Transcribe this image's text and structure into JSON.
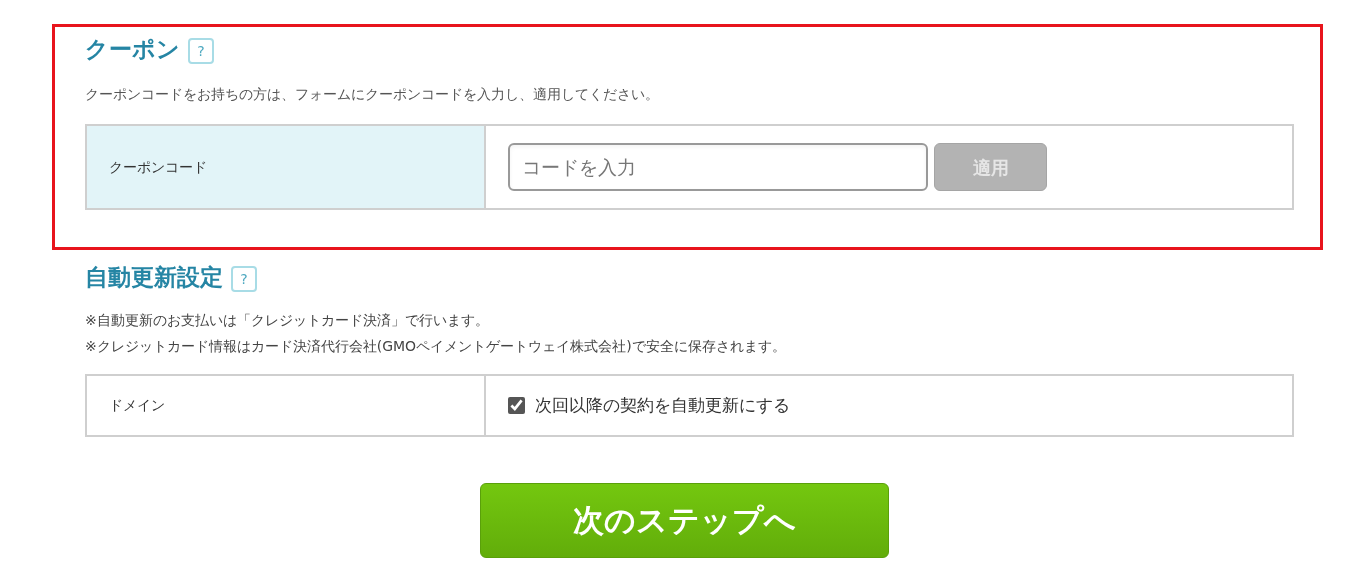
{
  "coupon": {
    "title": "クーポン",
    "help": "?",
    "description": "クーポンコードをお持ちの方は、フォームにクーポンコードを入力し、適用してください。",
    "label": "クーポンコード",
    "placeholder": "コードを入力",
    "apply_button": {
      "label": "適用",
      "disabled": true
    }
  },
  "auto_renew": {
    "title": "自動更新設定",
    "help": "?",
    "notes": [
      "※自動更新のお支払いは「クレジットカード決済」で行います。",
      "※クレジットカード情報はカード決済代行会社(GMOペイメントゲートウェイ株式会社)で安全に保存されます。"
    ],
    "label": "ドメイン",
    "checkbox": {
      "label": "次回以降の契約を自動更新にする",
      "checked": true
    }
  },
  "next_button": "次のステップへ"
}
